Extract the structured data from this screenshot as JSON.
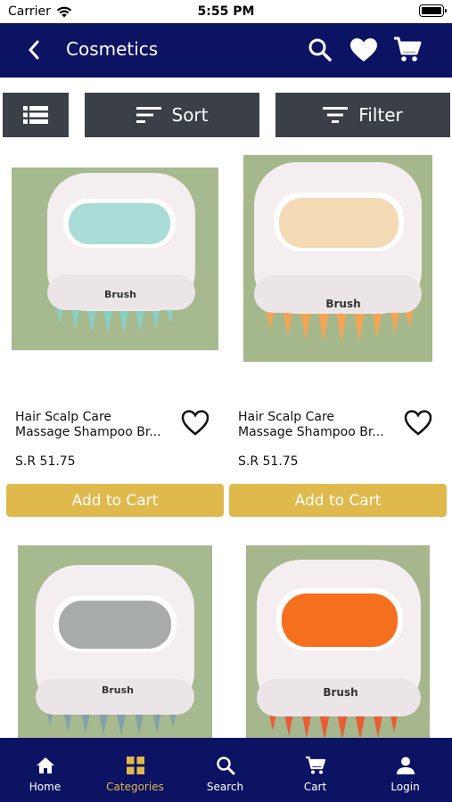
{
  "status": {
    "carrier": "Carrier",
    "time": "5:55 PM"
  },
  "header": {
    "title": "Cosmetics"
  },
  "toolbar": {
    "sort_label": "Sort",
    "filter_label": "Filter"
  },
  "products": [
    {
      "name_line1": "Hair Scalp Care",
      "name_line2": "Massage Shampoo Br...",
      "price": "S.R 51.75",
      "add_label": "Add to Cart",
      "bg": "#a7b98f",
      "window": "#a9dcd7",
      "bristle": "#8ccfc3",
      "brand": "Brush"
    },
    {
      "name_line1": "Hair Scalp Care",
      "name_line2": "Massage Shampoo Br...",
      "price": "S.R 51.75",
      "add_label": "Add to Cart",
      "bg": "#a5b88c",
      "window": "#f3d9b4",
      "bristle": "#f3a455",
      "brand": "Brush"
    },
    {
      "name_line1": "",
      "name_line2": "",
      "price": "",
      "add_label": "",
      "bg": "#a7b98f",
      "window": "#a7abaa",
      "bristle": "#7fa3a8",
      "brand": "Brush"
    },
    {
      "name_line1": "",
      "name_line2": "",
      "price": "",
      "add_label": "",
      "bg": "#a6b68d",
      "window": "#f56f1f",
      "bristle": "#e85c33",
      "brand": "Brush"
    }
  ],
  "nav": {
    "home": "Home",
    "categories": "Categories",
    "search": "Search",
    "cart": "Cart",
    "login": "Login"
  },
  "colors": {
    "brand_navy": "#0d1363",
    "accent_gold": "#e0b94c",
    "toolbar_gray": "#3a3f48"
  }
}
